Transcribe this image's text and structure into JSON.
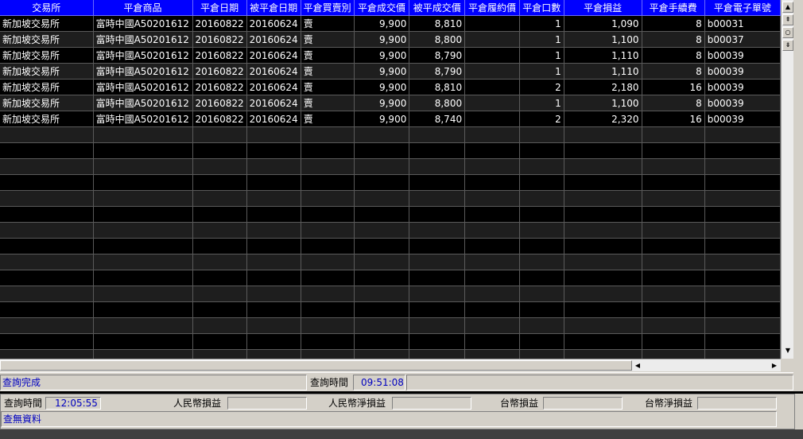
{
  "grid": {
    "columns": [
      "交易所",
      "平倉商品",
      "平倉日期",
      "被平倉日期",
      "平倉買賣別",
      "平倉成交價",
      "被平成交價",
      "平倉履約價",
      "平倉口數",
      "平倉損益",
      "平倉手續費",
      "平倉電子單號"
    ],
    "rows": [
      [
        "新加坡交易所",
        "富時中國A50201612",
        "20160822",
        "20160624",
        "賣",
        "9,900",
        "8,810",
        "",
        "1",
        "1,090",
        "8",
        "b00031"
      ],
      [
        "新加坡交易所",
        "富時中國A50201612",
        "20160822",
        "20160624",
        "賣",
        "9,900",
        "8,800",
        "",
        "1",
        "1,100",
        "8",
        "b00037"
      ],
      [
        "新加坡交易所",
        "富時中國A50201612",
        "20160822",
        "20160624",
        "賣",
        "9,900",
        "8,790",
        "",
        "1",
        "1,110",
        "8",
        "b00039"
      ],
      [
        "新加坡交易所",
        "富時中國A50201612",
        "20160822",
        "20160624",
        "賣",
        "9,900",
        "8,790",
        "",
        "1",
        "1,110",
        "8",
        "b00039"
      ],
      [
        "新加坡交易所",
        "富時中國A50201612",
        "20160822",
        "20160624",
        "賣",
        "9,900",
        "8,810",
        "",
        "2",
        "2,180",
        "16",
        "b00039"
      ],
      [
        "新加坡交易所",
        "富時中國A50201612",
        "20160822",
        "20160624",
        "賣",
        "9,900",
        "8,800",
        "",
        "1",
        "1,100",
        "8",
        "b00039"
      ],
      [
        "新加坡交易所",
        "富時中國A50201612",
        "20160822",
        "20160624",
        "賣",
        "9,900",
        "8,740",
        "",
        "2",
        "2,320",
        "16",
        "b00039"
      ]
    ],
    "empty_rows": 15
  },
  "status": {
    "message": "查詢完成",
    "query_time_label": "查詢時間",
    "query_time": "09:51:08"
  },
  "summary": {
    "query_time_label": "查詢時間",
    "query_time": "12:05:55",
    "rmb_pl_label": "人民幣損益",
    "rmb_net_pl_label": "人民幣淨損益",
    "twd_pl_label": "台幣損益",
    "twd_net_pl_label": "台幣淨損益",
    "message": "查無資料"
  },
  "icons": {
    "scroll_up": "arrow-up-icon",
    "page_up": "double-arrow-up-icon",
    "reset": "circle-icon",
    "page_down": "double-arrow-down-icon",
    "scroll_down": "arrow-down-icon",
    "scroll_left": "arrow-left-icon",
    "scroll_right": "arrow-right-icon"
  }
}
